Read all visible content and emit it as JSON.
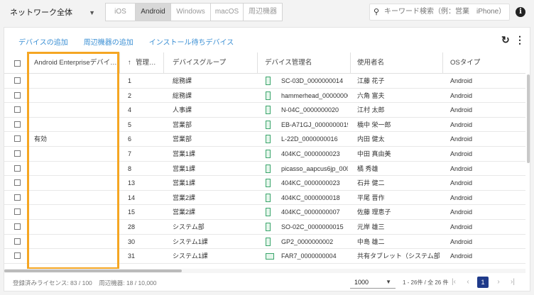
{
  "top": {
    "network_select": "ネットワーク全体",
    "os_tabs": [
      "iOS",
      "Android",
      "Windows",
      "macOS",
      "周辺機器"
    ],
    "active_tab": "Android",
    "search_placeholder": "キーワード検索（例：営業　iPhone）"
  },
  "actions": {
    "add_device": "デバイスの追加",
    "add_peripheral": "周辺機器の追加",
    "install_waiting": "インストール待ちデバイス"
  },
  "columns": [
    "Android Enterpriseデバイ…",
    "管理…",
    "デバイスグループ",
    "デバイス管理名",
    "使用者名",
    "OSタイプ"
  ],
  "rows": [
    {
      "ae": "",
      "num": "1",
      "group": "総務課",
      "name": "SC-03D_0000000014",
      "user": "江藤 花子",
      "os": "Android",
      "device": "phone"
    },
    {
      "ae": "",
      "num": "2",
      "group": "総務課",
      "name": "hammerhead_00000000…",
      "user": "六角 富夫",
      "os": "Android",
      "device": "phone"
    },
    {
      "ae": "",
      "num": "4",
      "group": "人事課",
      "name": "N-04C_0000000020",
      "user": "江村 太郎",
      "os": "Android",
      "device": "phone"
    },
    {
      "ae": "",
      "num": "5",
      "group": "営業部",
      "name": "EB-A71GJ_0000000019",
      "user": "橋中 栄一郎",
      "os": "Android",
      "device": "phone"
    },
    {
      "ae": "有効",
      "num": "6",
      "group": "営業部",
      "name": "L-22D_0000000016",
      "user": "内田 健太",
      "os": "Android",
      "device": "phone"
    },
    {
      "ae": "",
      "num": "7",
      "group": "営業1課",
      "name": "404KC_0000000023",
      "user": "中田 真由美",
      "os": "Android",
      "device": "phone"
    },
    {
      "ae": "",
      "num": "8",
      "group": "営業1課",
      "name": "picasso_aapcus6jp_000…",
      "user": "橘 秀雄",
      "os": "Android",
      "device": "phone"
    },
    {
      "ae": "",
      "num": "13",
      "group": "営業1課",
      "name": "404KC_0000000023",
      "user": "石井 健二",
      "os": "Android",
      "device": "phone"
    },
    {
      "ae": "",
      "num": "14",
      "group": "営業2課",
      "name": "404KC_0000000018",
      "user": "平尾 晋作",
      "os": "Android",
      "device": "phone"
    },
    {
      "ae": "",
      "num": "15",
      "group": "営業2課",
      "name": "404KC_0000000007",
      "user": "佐藤 理恵子",
      "os": "Android",
      "device": "phone"
    },
    {
      "ae": "",
      "num": "28",
      "group": "システム部",
      "name": "SO-02C_0000000015",
      "user": "元岸 雄三",
      "os": "Android",
      "device": "phone"
    },
    {
      "ae": "",
      "num": "30",
      "group": "システム1課",
      "name": "GP2_0000000002",
      "user": "中島 雄二",
      "os": "Android",
      "device": "phone"
    },
    {
      "ae": "",
      "num": "31",
      "group": "システム1課",
      "name": "FAR7_0000000004",
      "user": "共有タブレット（システム部…",
      "os": "Android",
      "device": "tablet"
    }
  ],
  "footer": {
    "license": "登録済みライセンス: 83 / 100",
    "peripheral": "周辺機器: 18 / 10,000",
    "per_page": "1000",
    "range": "1 - 26件 / 全 26 件",
    "current_page": "1"
  },
  "colors": {
    "link": "#3a8fd4",
    "highlight": "#f5a623",
    "pager": "#1f3a8a",
    "device_icon": "#3aa56b"
  }
}
